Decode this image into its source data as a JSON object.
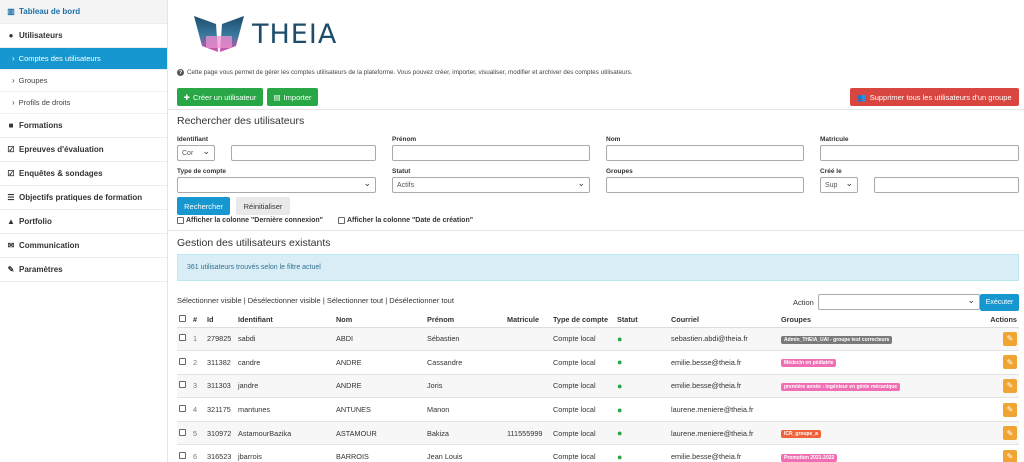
{
  "sidebar": {
    "dashboard": "Tableau de bord",
    "users": "Utilisateurs",
    "accounts": "Comptes des utilisateurs",
    "groups": "Groupes",
    "profiles": "Profils de droits",
    "trainings": "Formations",
    "exams": "Epreuves d'évaluation",
    "surveys": "Enquêtes & sondages",
    "objectives": "Objectifs pratiques de formation",
    "portfolio": "Portfolio",
    "communication": "Communication",
    "settings": "Paramètres"
  },
  "logo": {
    "text": "THEIA"
  },
  "info_text": "Cette page vous permet de gérer les comptes utilisateurs de la plateforme. Vous pouvez créer, importer, visualiser, modifier et archiver des comptes utilisateurs.",
  "toolbar": {
    "create": "Créer un utilisateur",
    "import": "Importer",
    "delete_group": "Supprimer tous les utilisateurs d'un groupe"
  },
  "search": {
    "title": "Rechercher des utilisateurs",
    "identifiant_label": "Identifiant",
    "identifiant_op": "Cor",
    "prenom_label": "Prénom",
    "nom_label": "Nom",
    "matricule_label": "Matricule",
    "type_label": "Type de compte",
    "statut_label": "Statut",
    "statut_value": "Actifs",
    "groupes_label": "Groupes",
    "cree_label": "Créé le",
    "cree_op": "Sup",
    "search_btn": "Rechercher",
    "reset_btn": "Réinitialiser",
    "col_last_login": "Afficher la colonne \"Dernière connexion\"",
    "col_created": "Afficher la colonne \"Date de création\""
  },
  "manage": {
    "title": "Gestion des utilisateurs existants",
    "alert": "361 utilisateurs trouvés selon le filtre actuel",
    "select_visible": "Sélectionner visible",
    "deselect_visible": "Désélectionner visible",
    "select_all": "Sélectionner tout",
    "deselect_all": "Désélectionner tout",
    "sep": "|",
    "action_label": "Action",
    "execute": "Exécuter"
  },
  "table": {
    "headers": [
      "#",
      "Id",
      "Identifiant",
      "Nom",
      "Prénom",
      "Matricule",
      "Type de compte",
      "Statut",
      "Courriel",
      "Groupes",
      "Actions"
    ],
    "rows": [
      {
        "n": "1",
        "id": "279825",
        "login": "sabdi",
        "nom": "ABDI",
        "prenom": "Sébastien",
        "matricule": "",
        "type": "Compte local",
        "email": "sebastien.abdi@theia.fr",
        "group": "Admin_THEIA_UAI - groupe test correcteurs",
        "group_color": "#7a7a7a"
      },
      {
        "n": "2",
        "id": "311382",
        "login": "candre",
        "nom": "ANDRE",
        "prenom": "Cassandre",
        "matricule": "",
        "type": "Compte local",
        "email": "emilie.besse@theia.fr",
        "group": "Médecin en pédiatrie",
        "group_color": "#f06fb4"
      },
      {
        "n": "3",
        "id": "311303",
        "login": "jandre",
        "nom": "ANDRE",
        "prenom": "Joris",
        "matricule": "",
        "type": "Compte local",
        "email": "emilie.besse@theia.fr",
        "group": "première année - ingénieur en génie mécanique",
        "group_color": "#f06fb4"
      },
      {
        "n": "4",
        "id": "321175",
        "login": "mantunes",
        "nom": "ANTUNES",
        "prenom": "Manon",
        "matricule": "",
        "type": "Compte local",
        "email": "laurene.meniere@theia.fr",
        "group": "",
        "group_color": ""
      },
      {
        "n": "5",
        "id": "310972",
        "login": "AstamourBazika",
        "nom": "ASTAMOUR",
        "prenom": "Bakiza",
        "matricule": "111555999",
        "type": "Compte local",
        "email": "laurene.meniere@theia.fr",
        "group": "ICR_groupe_a",
        "group_color": "#f0623c"
      },
      {
        "n": "6",
        "id": "316523",
        "login": "jbarrois",
        "nom": "BARROIS",
        "prenom": "Jean Louis",
        "matricule": "",
        "type": "Compte local",
        "email": "emilie.besse@theia.fr",
        "group": "Promotion 2021-2022",
        "group_color": "#f06fb4"
      }
    ]
  },
  "colors": {
    "primary": "#1797cf",
    "success": "#29a746",
    "danger": "#d9453f",
    "warning": "#f0a532"
  },
  "icons": {
    "user_status": "user-icon",
    "edit": "pencil-icon"
  }
}
